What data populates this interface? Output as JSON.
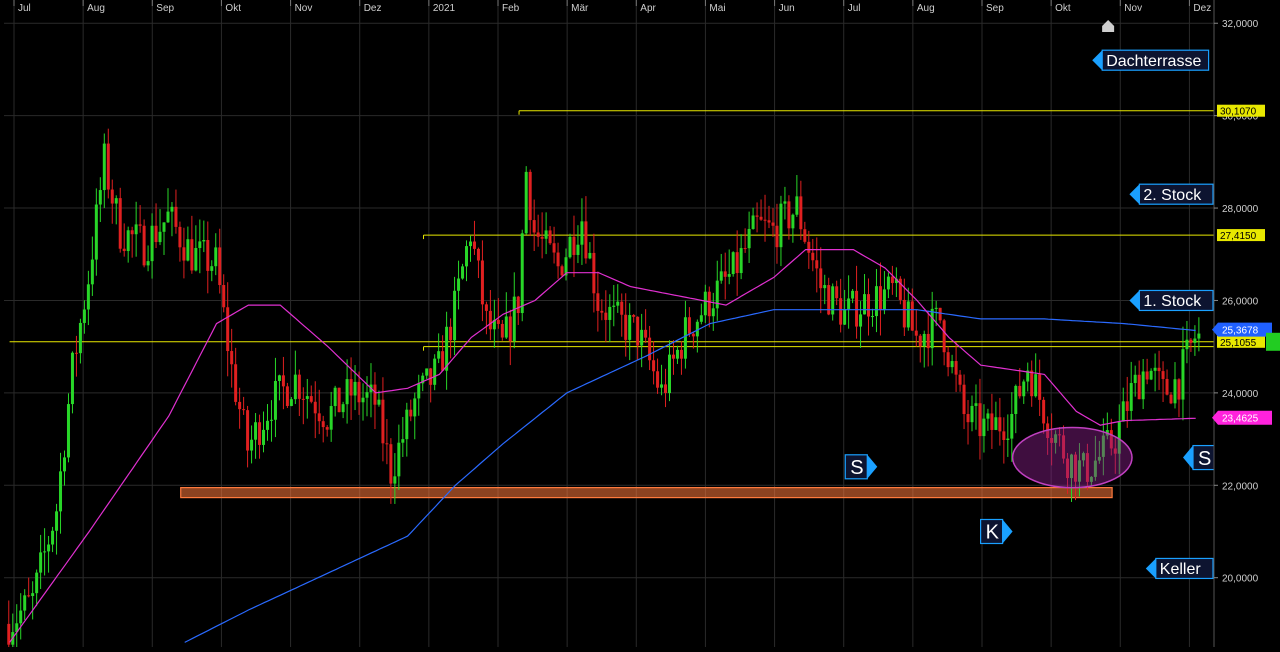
{
  "chart_data": {
    "type": "candlestick",
    "months": [
      "Jul",
      "Aug",
      "Sep",
      "Okt",
      "Nov",
      "Dez",
      "2021",
      "Feb",
      "Mär",
      "Apr",
      "Mai",
      "Jun",
      "Jul",
      "Aug",
      "Sep",
      "Okt",
      "Nov",
      "Dez"
    ],
    "y_ticks": [
      "32,0000",
      "30,0000",
      "28,0000",
      "26,0000",
      "24,0000",
      "22,0000",
      "20,0000"
    ],
    "y_tick_values": [
      32,
      30,
      28,
      26,
      24,
      22,
      20
    ],
    "ylim": [
      18.5,
      32.2
    ],
    "grid": true,
    "price_path": [
      [
        0,
        19.0
      ],
      [
        3,
        19.5
      ],
      [
        6,
        21.5
      ],
      [
        8,
        24.5
      ],
      [
        10,
        26.5
      ],
      [
        12,
        29.0
      ],
      [
        14,
        27.5
      ],
      [
        17,
        27.2
      ],
      [
        20,
        27.8
      ],
      [
        23,
        27.0
      ],
      [
        26,
        26.8
      ],
      [
        28,
        24.5
      ],
      [
        30,
        22.8
      ],
      [
        33,
        23.8
      ],
      [
        36,
        24.3
      ],
      [
        40,
        23.5
      ],
      [
        43,
        24.0
      ],
      [
        46,
        23.8
      ],
      [
        48,
        22.3
      ],
      [
        51,
        23.8
      ],
      [
        54,
        24.5
      ],
      [
        56,
        25.8
      ],
      [
        58,
        27.5
      ],
      [
        60,
        25.5
      ],
      [
        62,
        25.0
      ],
      [
        64,
        26.0
      ],
      [
        65,
        28.8
      ],
      [
        66,
        27.5
      ],
      [
        69,
        26.7
      ],
      [
        72,
        27.8
      ],
      [
        74,
        26.0
      ],
      [
        76,
        25.6
      ],
      [
        79,
        25.3
      ],
      [
        82,
        24.0
      ],
      [
        85,
        25.3
      ],
      [
        88,
        26.0
      ],
      [
        91,
        26.6
      ],
      [
        94,
        27.6
      ],
      [
        96,
        27.5
      ],
      [
        99,
        28.0
      ],
      [
        102,
        26.3
      ],
      [
        105,
        25.7
      ],
      [
        108,
        26.0
      ],
      [
        111,
        26.2
      ],
      [
        114,
        25.2
      ],
      [
        117,
        25.6
      ],
      [
        120,
        23.5
      ],
      [
        123,
        23.2
      ],
      [
        126,
        23.5
      ],
      [
        128,
        24.6
      ],
      [
        131,
        23.2
      ],
      [
        133,
        22.6
      ],
      [
        135,
        22.3
      ],
      [
        137,
        22.6
      ],
      [
        139,
        23.0
      ],
      [
        141,
        24.0
      ],
      [
        143,
        24.6
      ],
      [
        145,
        24.0
      ],
      [
        147,
        24.3
      ],
      [
        149,
        25.2
      ]
    ],
    "total_bars": 150,
    "sma_short_path": [
      [
        0,
        18.6
      ],
      [
        10,
        21.0
      ],
      [
        20,
        23.5
      ],
      [
        26,
        25.5
      ],
      [
        30,
        25.9
      ],
      [
        34,
        25.9
      ],
      [
        40,
        25.0
      ],
      [
        46,
        24.0
      ],
      [
        50,
        24.1
      ],
      [
        54,
        24.4
      ],
      [
        58,
        25.2
      ],
      [
        62,
        25.7
      ],
      [
        66,
        26.0
      ],
      [
        70,
        26.6
      ],
      [
        74,
        26.6
      ],
      [
        78,
        26.3
      ],
      [
        84,
        26.1
      ],
      [
        90,
        25.9
      ],
      [
        96,
        26.5
      ],
      [
        100,
        27.1
      ],
      [
        106,
        27.1
      ],
      [
        110,
        26.7
      ],
      [
        114,
        26.0
      ],
      [
        118,
        25.2
      ],
      [
        122,
        24.6
      ],
      [
        126,
        24.5
      ],
      [
        130,
        24.4
      ],
      [
        134,
        23.6
      ],
      [
        137,
        23.3
      ],
      [
        140,
        23.4
      ],
      [
        149,
        23.45
      ]
    ],
    "sma_long_path": [
      [
        22,
        18.6
      ],
      [
        30,
        19.3
      ],
      [
        40,
        20.1
      ],
      [
        50,
        20.9
      ],
      [
        56,
        22.0
      ],
      [
        62,
        22.9
      ],
      [
        70,
        24.0
      ],
      [
        80,
        24.8
      ],
      [
        88,
        25.5
      ],
      [
        96,
        25.8
      ],
      [
        106,
        25.8
      ],
      [
        114,
        25.8
      ],
      [
        122,
        25.6
      ],
      [
        130,
        25.6
      ],
      [
        140,
        25.5
      ],
      [
        149,
        25.35
      ]
    ],
    "hlines": [
      {
        "price": 30.107,
        "from": 64,
        "label": "30,1070",
        "color": "#e8e800"
      },
      {
        "price": 27.415,
        "from": 52,
        "label": "27,4150",
        "color": "#e8e800"
      },
      {
        "price": 25.1055,
        "from": 0,
        "label": "25,1055",
        "color": "#e8e800"
      },
      {
        "price": 25.0,
        "from": 52,
        "label": "",
        "color": "#e8e800"
      }
    ],
    "tags": [
      {
        "price": 25.3678,
        "label": "25,3678",
        "bg": "#2060ff"
      },
      {
        "price": 23.4625,
        "label": "23,4625",
        "bg": "#ff22dd"
      }
    ],
    "support_zone": {
      "from": 22,
      "to": 138,
      "top": 21.95,
      "bottom": 21.75,
      "color": "#ff7a3d"
    },
    "ellipse": {
      "center_x": 133.5,
      "center_price": 22.6,
      "rx_bars": 7.5,
      "ry_price": 0.65
    },
    "annotations": [
      {
        "name": "label-dachterrasse",
        "text": "Dachterrasse",
        "bar": 136,
        "price": 31.2,
        "arrow": "left",
        "size": "normal"
      },
      {
        "name": "label-2-stock",
        "text": "2. Stock",
        "bar": 143,
        "price": 28.3,
        "arrow": "left",
        "size": "normal"
      },
      {
        "name": "label-1-stock",
        "text": "1. Stock",
        "bar": 149,
        "price": 26.0,
        "arrow": "left",
        "size": "normal"
      },
      {
        "name": "label-s-left",
        "text": "S",
        "bar": 109,
        "price": 22.4,
        "arrow": "right",
        "size": "big"
      },
      {
        "name": "label-s-right",
        "text": "S",
        "bar": 149,
        "price": 22.6,
        "arrow": "left",
        "size": "big"
      },
      {
        "name": "label-k",
        "text": "K",
        "bar": 126,
        "price": 21.0,
        "arrow": "right",
        "size": "big"
      },
      {
        "name": "label-keller",
        "text": "Keller",
        "bar": 144,
        "price": 20.2,
        "arrow": "left",
        "size": "normal"
      }
    ]
  },
  "colors": {
    "background": "#000000",
    "grid": "#2a2a2a",
    "up_candle": "#28d628",
    "down_candle": "#e02020",
    "sma_short": "#e030d0",
    "sma_long": "#2a6aff",
    "hline": "#e8e800",
    "label_bg": "#0d1430",
    "label_arrow": "#1aa0ff",
    "last_price_bg": "#22cc22"
  }
}
